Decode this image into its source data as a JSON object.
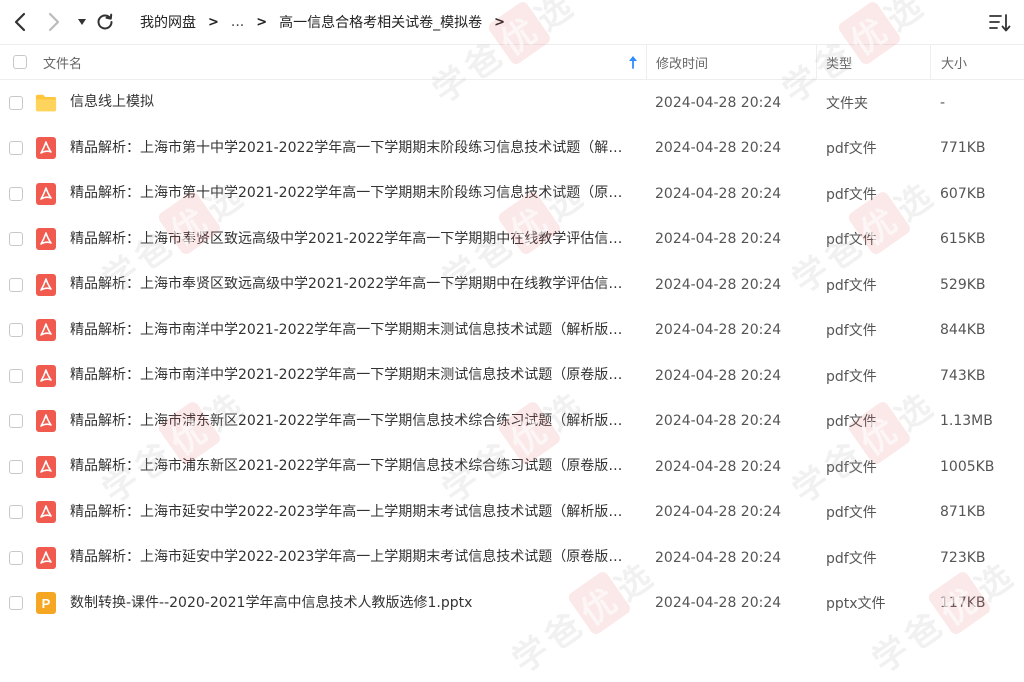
{
  "nav": {
    "back_icon": "chevron-left-icon",
    "forward_icon": "chevron-right-icon",
    "dropdown_icon": "caret-down-icon",
    "refresh_icon": "refresh-icon"
  },
  "breadcrumb": {
    "root": "我的网盘",
    "separator": ">",
    "ellipsis": "...",
    "current": "高一信息合格考相关试卷_模拟卷"
  },
  "header": {
    "name": "文件名",
    "modified": "修改时间",
    "type": "类型",
    "size": "大小"
  },
  "watermark": {
    "first": "学爸",
    "middle": "优",
    "last": "选"
  },
  "files": [
    {
      "icon": "folder-icon",
      "name": "信息线上模拟",
      "modified": "2024-04-28 20:24",
      "type": "文件夹",
      "size": "-"
    },
    {
      "icon": "pdf-icon",
      "name": "精品解析：上海市第十中学2021-2022学年高一下学期期末阶段练习信息技术试题（解析版）.pdf",
      "modified": "2024-04-28 20:24",
      "type": "pdf文件",
      "size": "771KB"
    },
    {
      "icon": "pdf-icon",
      "name": "精品解析：上海市第十中学2021-2022学年高一下学期期末阶段练习信息技术试题（原卷版）.pdf",
      "modified": "2024-04-28 20:24",
      "type": "pdf文件",
      "size": "607KB"
    },
    {
      "icon": "pdf-icon",
      "name": "精品解析：上海市奉贤区致远高级中学2021-2022学年高一下学期期中在线教学评估信息技术试题（解析版）.pdf",
      "modified": "2024-04-28 20:24",
      "type": "pdf文件",
      "size": "615KB"
    },
    {
      "icon": "pdf-icon",
      "name": "精品解析：上海市奉贤区致远高级中学2021-2022学年高一下学期期中在线教学评估信息技术试题（原卷版）.pdf",
      "modified": "2024-04-28 20:24",
      "type": "pdf文件",
      "size": "529KB"
    },
    {
      "icon": "pdf-icon",
      "name": "精品解析：上海市南洋中学2021-2022学年高一下学期期末测试信息技术试题（解析版）.pdf",
      "modified": "2024-04-28 20:24",
      "type": "pdf文件",
      "size": "844KB"
    },
    {
      "icon": "pdf-icon",
      "name": "精品解析：上海市南洋中学2021-2022学年高一下学期期末测试信息技术试题（原卷版）.pdf",
      "modified": "2024-04-28 20:24",
      "type": "pdf文件",
      "size": "743KB"
    },
    {
      "icon": "pdf-icon",
      "name": "精品解析：上海市浦东新区2021-2022学年高一下学期信息技术综合练习试题（解析版）.pdf",
      "modified": "2024-04-28 20:24",
      "type": "pdf文件",
      "size": "1.13MB"
    },
    {
      "icon": "pdf-icon",
      "name": "精品解析：上海市浦东新区2021-2022学年高一下学期信息技术综合练习试题（原卷版）.pdf",
      "modified": "2024-04-28 20:24",
      "type": "pdf文件",
      "size": "1005KB"
    },
    {
      "icon": "pdf-icon",
      "name": "精品解析：上海市延安中学2022-2023学年高一上学期期末考试信息技术试题（解析版）.pdf",
      "modified": "2024-04-28 20:24",
      "type": "pdf文件",
      "size": "871KB"
    },
    {
      "icon": "pdf-icon",
      "name": "精品解析：上海市延安中学2022-2023学年高一上学期期末考试信息技术试题（原卷版）.pdf",
      "modified": "2024-04-28 20:24",
      "type": "pdf文件",
      "size": "723KB"
    },
    {
      "icon": "pptx-icon",
      "name": "数制转换-课件--2020-2021学年高中信息技术人教版选修1.pptx",
      "modified": "2024-04-28 20:24",
      "type": "pptx文件",
      "size": "117KB"
    }
  ],
  "colors": {
    "folder": "#FFC63D",
    "pdf": "#F05A4F",
    "pptx": "#F5A623",
    "sort_arrow": "#2F8CFF"
  }
}
